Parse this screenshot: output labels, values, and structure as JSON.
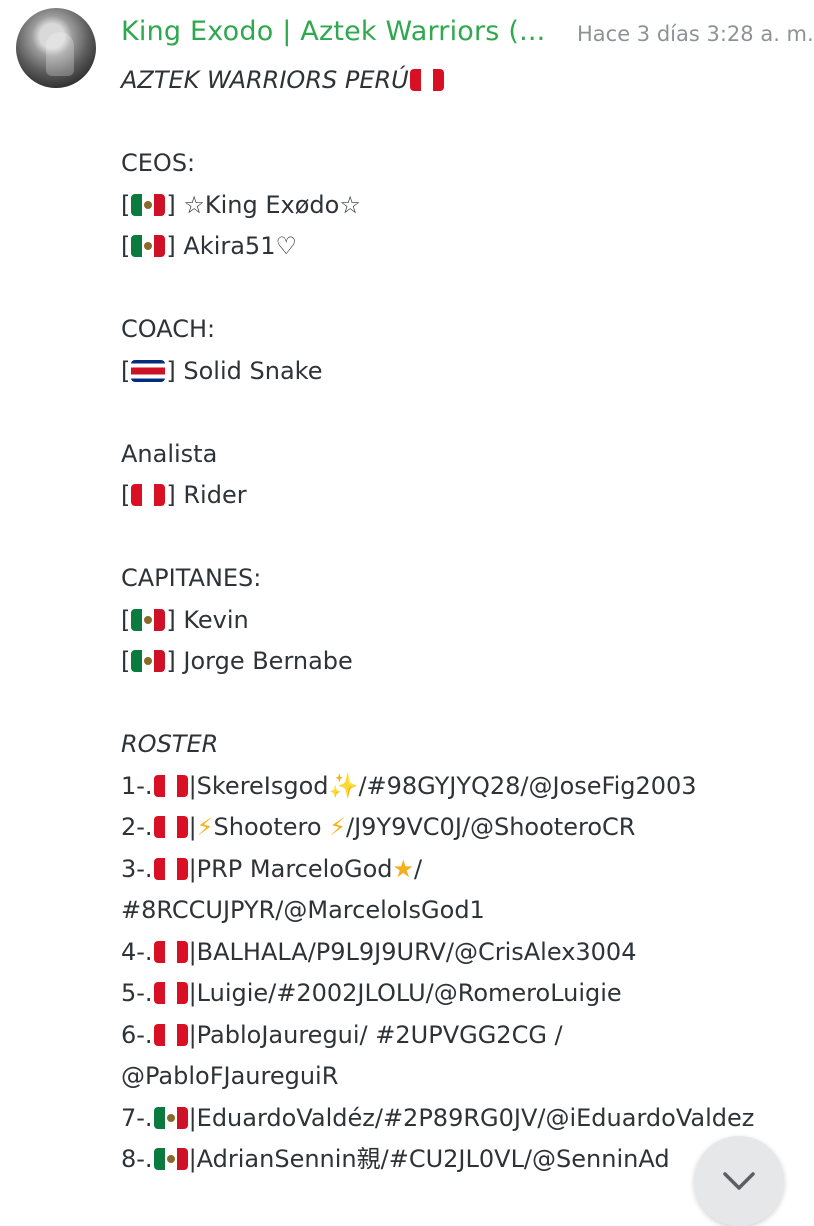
{
  "header": {
    "username": "King Exodo | Aztek Warriors (...",
    "timestamp": "Hace 3 días 3:28 a. m."
  },
  "icons": {
    "avatar": "user-avatar",
    "scroll_down": "chevron-down-icon"
  },
  "colors": {
    "username": "#2fa84f",
    "timestamp": "#8e9297",
    "text": "#2e3338"
  },
  "message": {
    "title": "AZTEK WARRIORS PERÚ",
    "ceos_heading": "CEOS:",
    "ceo1": "☆King Exødo☆",
    "ceo2": "Akira51♡",
    "coach_heading": "COACH:",
    "coach1": "Solid Snake",
    "analyst_heading": "Analista",
    "analyst1": "Rider",
    "captains_heading": "CAPITANES:",
    "captain1": "Kevin",
    "captain2": "Jorge Bernabe",
    "roster_heading": "ROSTER",
    "r1_num": "1-.",
    "r1_text": "SkereIsgod",
    "r1_tail": "/#98GYJYQ28/@JoseFig2003",
    "r2_num": "2-.",
    "r2_text": "Shootero ",
    "r2_tail": "/J9Y9VC0J/@ShooteroCR",
    "r3_num": "3-.",
    "r3_text": "PRP MarceloGod",
    "r3_tail": "/",
    "r3_cont": "#8RCCUJPYR/@MarceloIsGod1",
    "r4_num": "4-.",
    "r4_text": "BALHALA/P9L9J9URV/@CrisAlex3004",
    "r5_num": "5-.",
    "r5_text": "Luigie/#2002JLOLU/@RomeroLuigie",
    "r6_num": "6-.",
    "r6_text": "PabloJauregui/ #2UPVGG2CG /",
    "r6_cont": "@PabloFJaureguiR",
    "r7_num": "7-.",
    "r7_text": "EduardoValdéz/#2P89RG0JV/@iEduardoValdez",
    "r8_num": "8-.",
    "r8_text": "AdrianSennin親/#CU2JL0VL/@SenninAd"
  }
}
